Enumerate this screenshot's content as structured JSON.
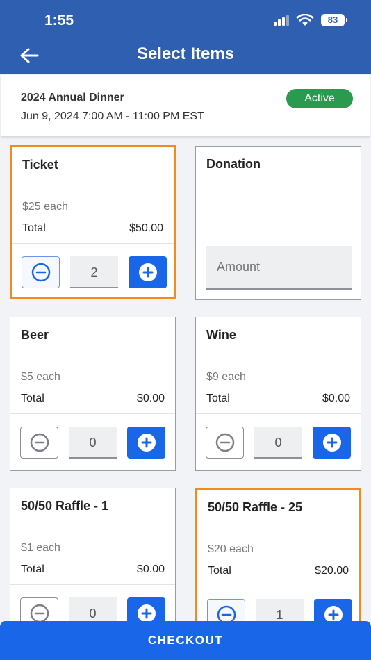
{
  "status_bar": {
    "time": "1:55",
    "battery": "83"
  },
  "header": {
    "title": "Select Items",
    "back_icon": "arrow-left-icon"
  },
  "event": {
    "name": "2024 Annual Dinner",
    "date_range": "Jun 9, 2024 7:00 AM - 11:00 PM EST",
    "status": "Active",
    "status_color": "#2a9a4e"
  },
  "items": [
    {
      "title": "Ticket",
      "price": "$25 each",
      "total_label": "Total",
      "total": "$50.00",
      "quantity": "2",
      "selected": true
    },
    {
      "title": "Donation",
      "amount_placeholder": "Amount"
    },
    {
      "title": "Beer",
      "price": "$5 each",
      "total_label": "Total",
      "total": "$0.00",
      "quantity": "0",
      "selected": false
    },
    {
      "title": "Wine",
      "price": "$9 each",
      "total_label": "Total",
      "total": "$0.00",
      "quantity": "0",
      "selected": false
    },
    {
      "title": "50/50 Raffle - 1",
      "price": "$1 each",
      "total_label": "Total",
      "total": "$0.00",
      "quantity": "0",
      "selected": false
    },
    {
      "title": "50/50 Raffle - 25",
      "price": "$20 each",
      "total_label": "Total",
      "total": "$20.00",
      "quantity": "1",
      "selected": true
    }
  ],
  "checkout_label": "CHECKOUT",
  "colors": {
    "header": "#2f5fb0",
    "accent": "#1a66e8",
    "selected_border": "#ef8c1f"
  }
}
